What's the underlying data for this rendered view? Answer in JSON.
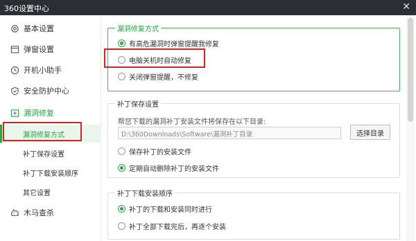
{
  "window": {
    "title": "360设置中心",
    "close_glyph": "✕"
  },
  "sidebar": {
    "items": [
      {
        "label": "基本设置",
        "icon": "gear-icon"
      },
      {
        "label": "弹窗设置",
        "icon": "window-icon"
      },
      {
        "label": "开机小助手",
        "icon": "clock-icon"
      },
      {
        "label": "安全防护中心",
        "icon": "shield-icon"
      },
      {
        "label": "漏洞修复",
        "icon": "patch-icon"
      }
    ],
    "sub_items": [
      {
        "label": "漏洞修复方式"
      },
      {
        "label": "补丁保存设置"
      },
      {
        "label": "补丁下载安装顺序"
      },
      {
        "label": "其它设置"
      }
    ],
    "last_item": {
      "label": "木马查杀",
      "icon": "trojan-icon"
    }
  },
  "repair_mode": {
    "title": "漏洞修复方式",
    "options": [
      {
        "label": "有高危漏洞时弹窗提醒我修复",
        "checked": true
      },
      {
        "label": "电脑关机时自动修复",
        "checked": false
      },
      {
        "label": "关闭弹窗提醒，不修复",
        "checked": false
      }
    ]
  },
  "patch_save": {
    "title": "补丁保存设置",
    "hint": "帮您下载的漏洞补丁安装文件将保存在以下目录:",
    "path": "D:\\360Downloads\\Software\\漏洞补丁目录",
    "choose_button": "选择目录",
    "options": [
      {
        "label": "保存补丁的安装文件",
        "checked": false
      },
      {
        "label": "定期自动删除补丁的安装文件",
        "checked": true
      }
    ]
  },
  "download_order": {
    "title": "补丁下载安装顺序",
    "options": [
      {
        "label": "补丁的下载和安装同时进行",
        "checked": true
      },
      {
        "label": "补丁全部下载完后，再逐个安装",
        "checked": false
      }
    ]
  },
  "colors": {
    "accent": "#27a644",
    "highlight": "#e0201e",
    "titlebar": "#2b2f33"
  }
}
